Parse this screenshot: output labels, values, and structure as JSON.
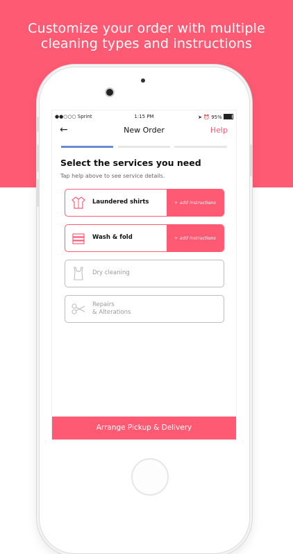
{
  "headline": {
    "line1": "Customize your order with multiple",
    "line2": "cleaning types and instructions"
  },
  "status_bar": {
    "carrier": "●●○○○ Sprint",
    "time": "1:15 PM",
    "battery": "95%"
  },
  "nav": {
    "back_icon": "←",
    "title": "New Order",
    "help": "Help"
  },
  "progress_steps": [
    1,
    0,
    0
  ],
  "section": {
    "title": "Select the services you need",
    "subtitle": "Tap help above to see service details."
  },
  "services": [
    {
      "label": "Laundered shirts",
      "action": "+ add instructions",
      "selected": true,
      "icon": "shirt-icon"
    },
    {
      "label": "Wash & fold",
      "action": "+ add instructions",
      "selected": true,
      "icon": "folded-clothes-icon"
    },
    {
      "label": "Dry cleaning",
      "selected": false,
      "icon": "tank-top-icon"
    },
    {
      "label_line1": "Repairs",
      "label_line2": "& Alterations",
      "selected": false,
      "icon": "scissors-icon"
    }
  ],
  "cta": {
    "label": "Arrange Pickup & Delivery"
  },
  "colors": {
    "accent": "#ff5a73",
    "progress": "#6a8ad6"
  }
}
